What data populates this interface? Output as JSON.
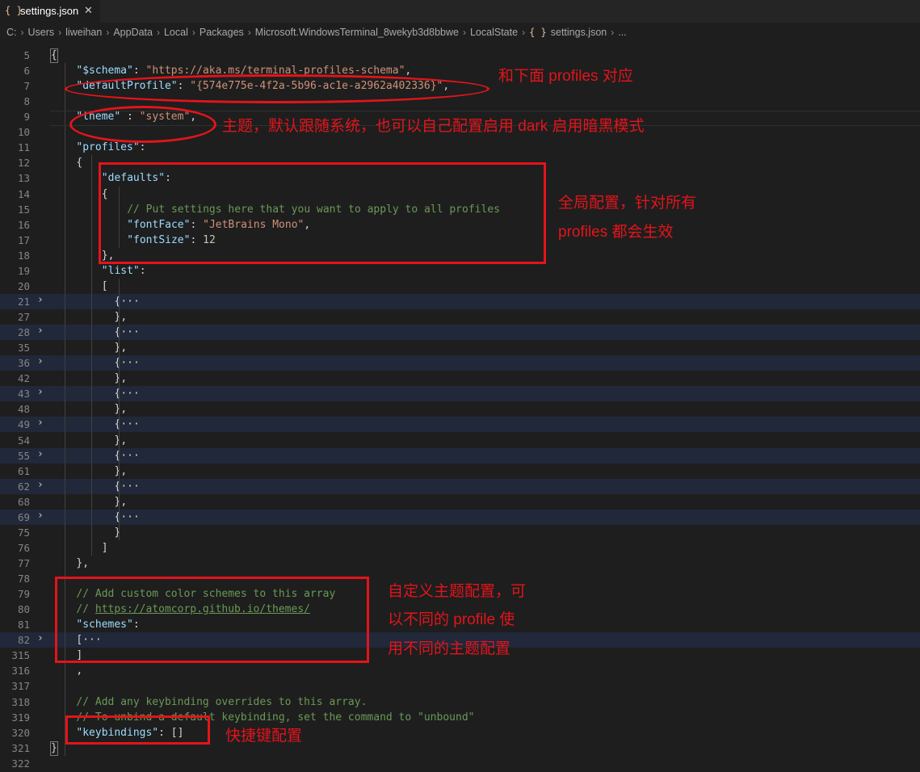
{
  "tab": {
    "label": "settings.json",
    "icon": "{ }",
    "close": "✕"
  },
  "breadcrumb": [
    "C:",
    "Users",
    "liweihan",
    "AppData",
    "Local",
    "Packages",
    "Microsoft.WindowsTerminal_8wekyb3d8bbwe",
    "LocalState",
    "settings.json",
    "..."
  ],
  "code_lines": [
    {
      "n": "5",
      "code": "{"
    },
    {
      "n": "6",
      "code": "\"$schema\": \"https://aka.ms/terminal-profiles-schema\","
    },
    {
      "n": "7",
      "code": "\"defaultProfile\": \"{574e775e-4f2a-5b96-ac1e-a2962a402336}\","
    },
    {
      "n": "8",
      "code": ""
    },
    {
      "n": "9",
      "code": "\"theme\" : \"system\","
    },
    {
      "n": "10",
      "code": ""
    },
    {
      "n": "11",
      "code": "\"profiles\":"
    },
    {
      "n": "12",
      "code": "{"
    },
    {
      "n": "13",
      "code": "\"defaults\":"
    },
    {
      "n": "14",
      "code": "{"
    },
    {
      "n": "15",
      "code": "// Put settings here that you want to apply to all profiles"
    },
    {
      "n": "16",
      "code": "\"fontFace\": \"JetBrains Mono\","
    },
    {
      "n": "17",
      "code": "\"fontSize\": 12"
    },
    {
      "n": "18",
      "code": "},"
    },
    {
      "n": "19",
      "code": "\"list\":"
    },
    {
      "n": "20",
      "code": "["
    },
    {
      "n": "21",
      "code": "{···"
    },
    {
      "n": "27",
      "code": "},"
    },
    {
      "n": "28",
      "code": "{···"
    },
    {
      "n": "35",
      "code": "},"
    },
    {
      "n": "36",
      "code": "{···"
    },
    {
      "n": "42",
      "code": "},"
    },
    {
      "n": "43",
      "code": "{···"
    },
    {
      "n": "48",
      "code": "},"
    },
    {
      "n": "49",
      "code": "{···"
    },
    {
      "n": "54",
      "code": "},"
    },
    {
      "n": "55",
      "code": "{···"
    },
    {
      "n": "61",
      "code": "},"
    },
    {
      "n": "62",
      "code": "{···"
    },
    {
      "n": "68",
      "code": "},"
    },
    {
      "n": "69",
      "code": "{···"
    },
    {
      "n": "75",
      "code": "}"
    },
    {
      "n": "76",
      "code": "]"
    },
    {
      "n": "77",
      "code": "},"
    },
    {
      "n": "78",
      "code": ""
    },
    {
      "n": "79",
      "code": "// Add custom color schemes to this array"
    },
    {
      "n": "80",
      "code": "// https://atomcorp.github.io/themes/"
    },
    {
      "n": "81",
      "code": "\"schemes\":"
    },
    {
      "n": "82",
      "code": "[···"
    },
    {
      "n": "315",
      "code": "]"
    },
    {
      "n": "316",
      "code": ","
    },
    {
      "n": "317",
      "code": ""
    },
    {
      "n": "318",
      "code": "// Add any keybinding overrides to this array."
    },
    {
      "n": "319",
      "code": "// To unbind a default keybinding, set the command to \"unbound\""
    },
    {
      "n": "320",
      "code": "\"keybindings\": []"
    },
    {
      "n": "321",
      "code": "}"
    },
    {
      "n": "322",
      "code": ""
    }
  ],
  "annotations": {
    "default_profile": "和下面 profiles 对应",
    "theme": "主题，默认跟随系统，也可以自己配置启用 dark 启用暗黑模式",
    "defaults_1": "全局配置，针对所有",
    "defaults_2": "profiles 都会生效",
    "schemes_1": "自定义主题配置，可",
    "schemes_2": "以不同的 profile 使",
    "schemes_3": "用不同的主题配置",
    "keybindings": "快捷键配置"
  },
  "colors": {
    "annotation": "#e3141b",
    "key": "#9cdcfe",
    "string": "#ce9178",
    "number": "#b5cea8",
    "comment": "#6a9955",
    "background": "#1e1e1e"
  }
}
